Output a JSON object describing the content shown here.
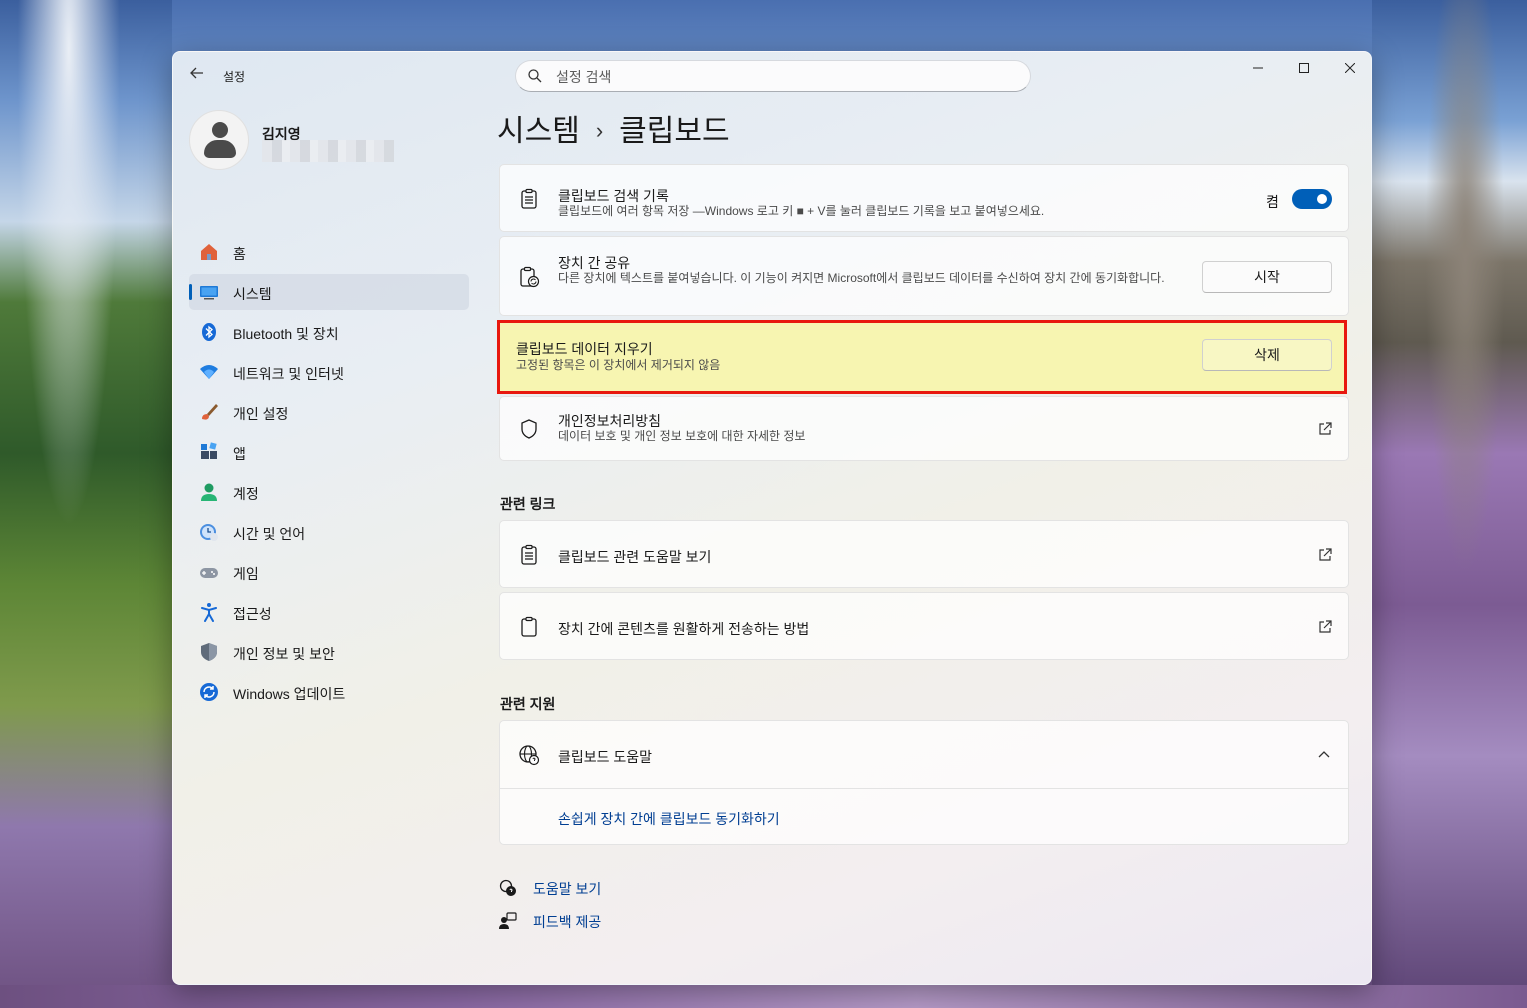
{
  "window": {
    "title": "설정",
    "search_placeholder": "설정 검색"
  },
  "profile": {
    "name": "김지영"
  },
  "sidebar": {
    "items": [
      {
        "label": "홈",
        "icon": "home-icon"
      },
      {
        "label": "시스템",
        "icon": "system-icon",
        "active": true
      },
      {
        "label": "Bluetooth 및 장치",
        "icon": "bluetooth-icon"
      },
      {
        "label": "네트워크 및 인터넷",
        "icon": "wifi-icon"
      },
      {
        "label": "개인 설정",
        "icon": "brush-icon"
      },
      {
        "label": "앱",
        "icon": "apps-icon"
      },
      {
        "label": "계정",
        "icon": "account-icon"
      },
      {
        "label": "시간 및 언어",
        "icon": "time-language-icon"
      },
      {
        "label": "게임",
        "icon": "gamepad-icon"
      },
      {
        "label": "접근성",
        "icon": "accessibility-icon"
      },
      {
        "label": "개인 정보 및 보안",
        "icon": "shield-icon"
      },
      {
        "label": "Windows 업데이트",
        "icon": "update-icon"
      }
    ]
  },
  "breadcrumb": {
    "parent": "시스템",
    "separator": "›",
    "current": "클립보드"
  },
  "settings": {
    "history": {
      "title": "클립보드 검색 기록",
      "desc": "클립보드에 여러 항목 저장 —Windows 로고 키 ■ + V를 눌러 클립보드 기록을 보고 붙여넣으세요.",
      "toggle_state": "켬",
      "toggle_on": true
    },
    "share": {
      "title": "장치 간 공유",
      "desc": "다른 장치에 텍스트를 붙여넣습니다. 이 기능이 켜지면 Microsoft에서 클립보드 데이터를 수신하여 장치 간에 동기화합니다.",
      "button": "시작"
    },
    "clear": {
      "title": "클립보드 데이터 지우기",
      "desc": "고정된 항목은 이 장치에서 제거되지 않음",
      "button": "삭제"
    },
    "privacy": {
      "title": "개인정보처리방침",
      "desc": "데이터 보호 및 개인 정보 보호에 대한 자세한 정보"
    }
  },
  "related_links": {
    "heading": "관련 링크",
    "items": [
      {
        "label": "클립보드 관련 도움말 보기"
      },
      {
        "label": "장치 간에 콘텐츠를 원활하게 전송하는 방법"
      }
    ]
  },
  "related_support": {
    "heading": "관련 지원",
    "title": "클립보드 도움말",
    "link": "손쉽게 장치 간에 클립보드 동기화하기"
  },
  "footer": {
    "help": "도움말 보기",
    "feedback": "피드백 제공"
  },
  "colors": {
    "accent": "#005fb8",
    "highlight_fill": "#f7f5b1",
    "highlight_border": "#e8180e"
  }
}
